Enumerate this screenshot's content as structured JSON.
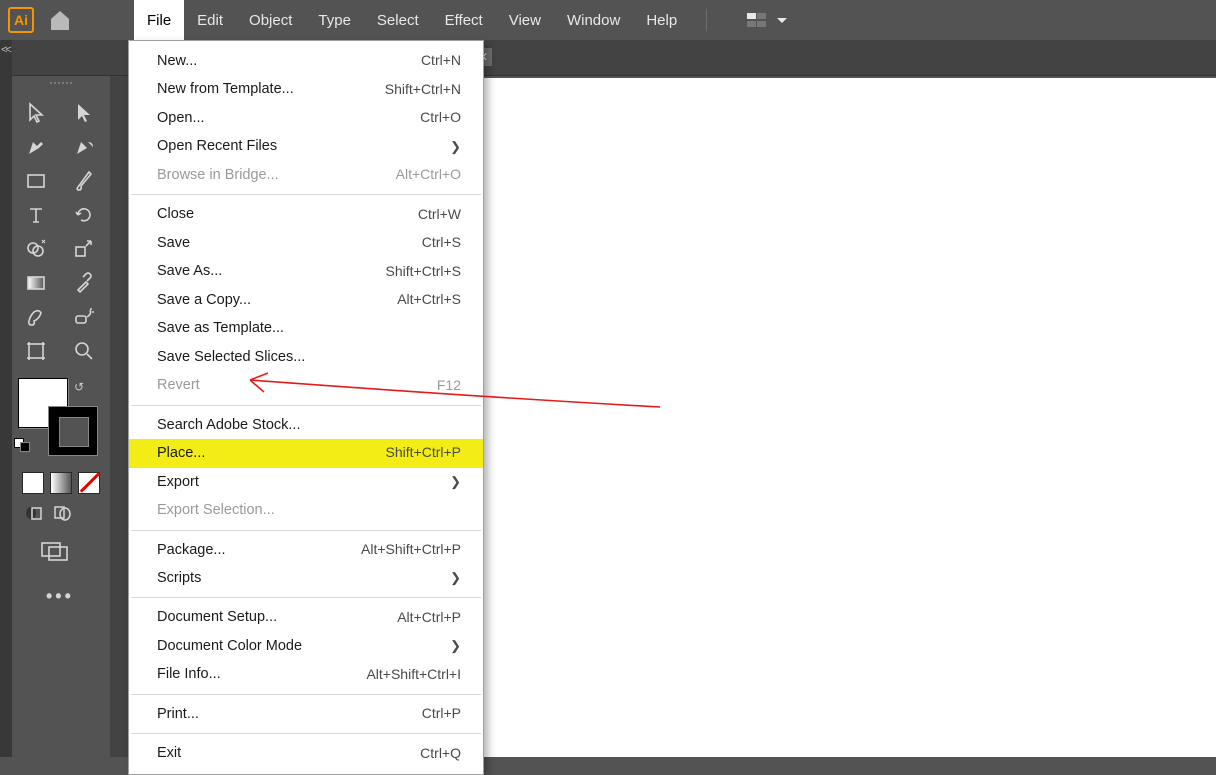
{
  "app": {
    "abbr": "Ai"
  },
  "menu": [
    "File",
    "Edit",
    "Object",
    "Type",
    "Select",
    "Effect",
    "View",
    "Window",
    "Help"
  ],
  "menu_active_index": 0,
  "file_menu": {
    "groups": [
      [
        {
          "label": "New...",
          "shortcut": "Ctrl+N"
        },
        {
          "label": "New from Template...",
          "shortcut": "Shift+Ctrl+N"
        },
        {
          "label": "Open...",
          "shortcut": "Ctrl+O"
        },
        {
          "label": "Open Recent Files",
          "submenu": true
        },
        {
          "label": "Browse in Bridge...",
          "shortcut": "Alt+Ctrl+O",
          "disabled": true
        }
      ],
      [
        {
          "label": "Close",
          "shortcut": "Ctrl+W"
        },
        {
          "label": "Save",
          "shortcut": "Ctrl+S"
        },
        {
          "label": "Save As...",
          "shortcut": "Shift+Ctrl+S"
        },
        {
          "label": "Save a Copy...",
          "shortcut": "Alt+Ctrl+S"
        },
        {
          "label": "Save as Template..."
        },
        {
          "label": "Save Selected Slices..."
        },
        {
          "label": "Revert",
          "shortcut": "F12",
          "disabled": true
        }
      ],
      [
        {
          "label": "Search Adobe Stock..."
        },
        {
          "label": "Place...",
          "shortcut": "Shift+Ctrl+P",
          "highlight": true
        },
        {
          "label": "Export",
          "submenu": true
        },
        {
          "label": "Export Selection...",
          "disabled": true
        }
      ],
      [
        {
          "label": "Package...",
          "shortcut": "Alt+Shift+Ctrl+P"
        },
        {
          "label": "Scripts",
          "submenu": true
        }
      ],
      [
        {
          "label": "Document Setup...",
          "shortcut": "Alt+Ctrl+P"
        },
        {
          "label": "Document Color Mode",
          "submenu": true
        },
        {
          "label": "File Info...",
          "shortcut": "Alt+Shift+Ctrl+I"
        }
      ],
      [
        {
          "label": "Print...",
          "shortcut": "Ctrl+P"
        }
      ],
      [
        {
          "label": "Exit",
          "shortcut": "Ctrl+Q"
        }
      ]
    ]
  }
}
